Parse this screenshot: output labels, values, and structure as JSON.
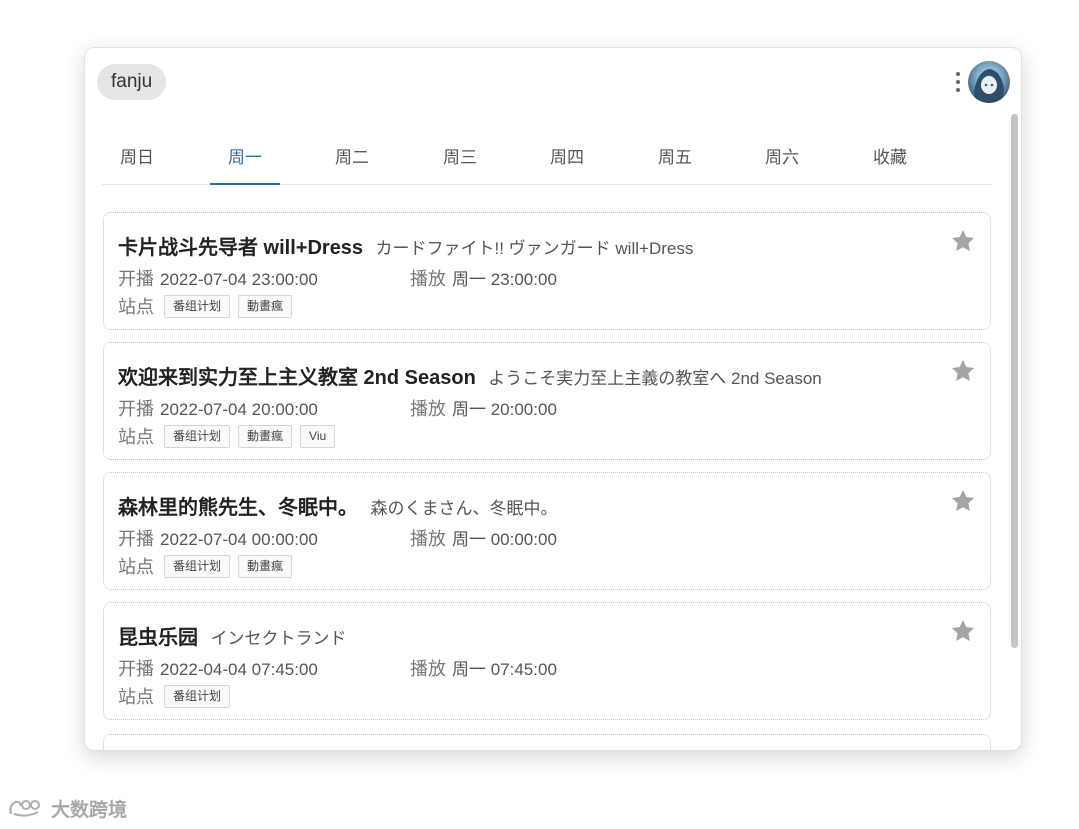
{
  "app": {
    "title": "fanju"
  },
  "tabs": [
    {
      "label": "周日",
      "active": false
    },
    {
      "label": "周一",
      "active": true
    },
    {
      "label": "周二",
      "active": false
    },
    {
      "label": "周三",
      "active": false
    },
    {
      "label": "周四",
      "active": false
    },
    {
      "label": "周五",
      "active": false
    },
    {
      "label": "周六",
      "active": false
    },
    {
      "label": "收藏",
      "active": false
    }
  ],
  "labels": {
    "start": "开播",
    "air": "播放",
    "sites": "站点"
  },
  "shows": [
    {
      "name_cn": "卡片战斗先导者 will+Dress",
      "name_jp": "カードファイト!! ヴァンガード will+Dress",
      "start": "2022-07-04 23:00:00",
      "air": "周一 23:00:00",
      "sites": [
        "番组计划",
        "動畫瘋"
      ]
    },
    {
      "name_cn": "欢迎来到实力至上主义教室 2nd Season",
      "name_jp": "ようこそ実力至上主義の教室へ 2nd Season",
      "start": "2022-07-04 20:00:00",
      "air": "周一 20:00:00",
      "sites": [
        "番组计划",
        "動畫瘋",
        "Viu"
      ]
    },
    {
      "name_cn": "森林里的熊先生、冬眠中。",
      "name_jp": "森のくまさん、冬眠中。",
      "start": "2022-07-04 00:00:00",
      "air": "周一 00:00:00",
      "sites": [
        "番组计划",
        "動畫瘋"
      ]
    },
    {
      "name_cn": "昆虫乐园",
      "name_jp": "インセクトランド",
      "start": "2022-04-04 07:45:00",
      "air": "周一 07:45:00",
      "sites": [
        "番组计划"
      ]
    }
  ],
  "watermark": "大数跨境",
  "colors": {
    "accent": "#2c6ea8",
    "star": "#a5a5a5"
  }
}
